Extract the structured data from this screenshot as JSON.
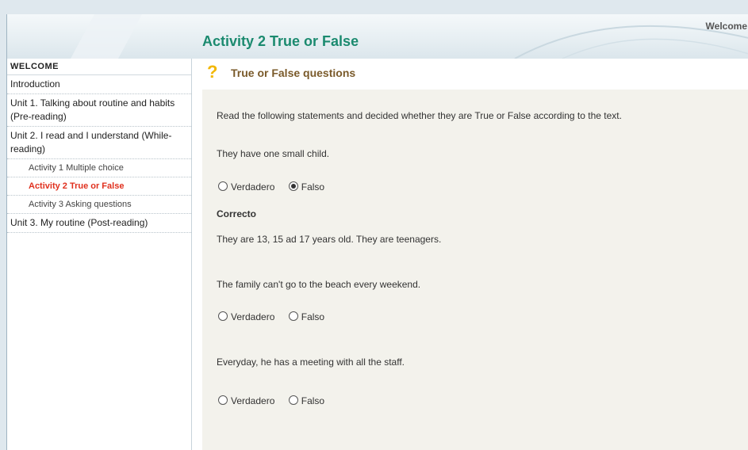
{
  "header": {
    "title": "Activity 2 True or False",
    "welcome": "Welcome"
  },
  "sidebar": {
    "heading": "WELCOME",
    "items": [
      {
        "label": "Introduction"
      },
      {
        "label": "Unit 1. Talking about routine and habits (Pre-reading)"
      },
      {
        "label": "Unit 2. I read and I understand (While-reading)"
      },
      {
        "label": "Activity 1 Multiple choice"
      },
      {
        "label": "Activity 2 True or False"
      },
      {
        "label": "Activity 3 Asking questions"
      },
      {
        "label": "Unit 3. My routine (Post-reading)"
      }
    ]
  },
  "section": {
    "icon": "question-icon",
    "title": "True or False questions"
  },
  "instructions": "Read the following statements and decided whether they are True or False according to the text.",
  "questions": [
    {
      "statement": "They have one small child.",
      "option_true": "Verdadero",
      "option_false": "Falso",
      "selected": "false",
      "feedback_label": "Correcto",
      "feedback_text": "They are 13, 15 ad 17 years old. They are teenagers."
    },
    {
      "statement": "The family can't go to the beach every weekend.",
      "option_true": "Verdadero",
      "option_false": "Falso"
    },
    {
      "statement": "Everyday, he has a meeting with all the staff.",
      "option_true": "Verdadero",
      "option_false": "Falso"
    }
  ],
  "colors": {
    "title": "#1b8a6f",
    "active_nav": "#e0301e",
    "section_title": "#7a5a2a",
    "panel_bg": "#f3f2ec"
  }
}
